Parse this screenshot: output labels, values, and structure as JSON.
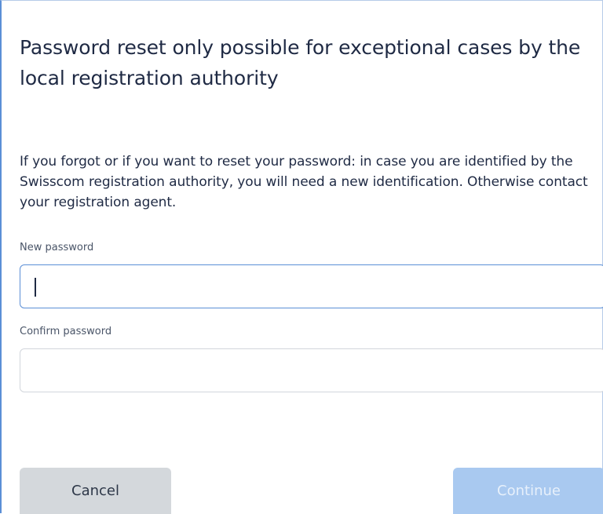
{
  "dialog": {
    "title": "Password reset only possible for exceptional cases by the local registration authority",
    "description": "If you forgot or if you want to reset your password: in case you are identified by the Swisscom registration authority, you will need a new identification. Otherwise contact your registration agent."
  },
  "form": {
    "new_password": {
      "label": "New password",
      "value": "",
      "placeholder": ""
    },
    "confirm_password": {
      "label": "Confirm password",
      "value": "",
      "placeholder": ""
    }
  },
  "actions": {
    "cancel_label": "Cancel",
    "continue_label": "Continue",
    "continue_disabled": true
  },
  "colors": {
    "accent": "#5b8fd6",
    "continue_disabled_bg": "#a9c9f0",
    "cancel_bg": "#d4d8dc",
    "text": "#1f2a44"
  }
}
